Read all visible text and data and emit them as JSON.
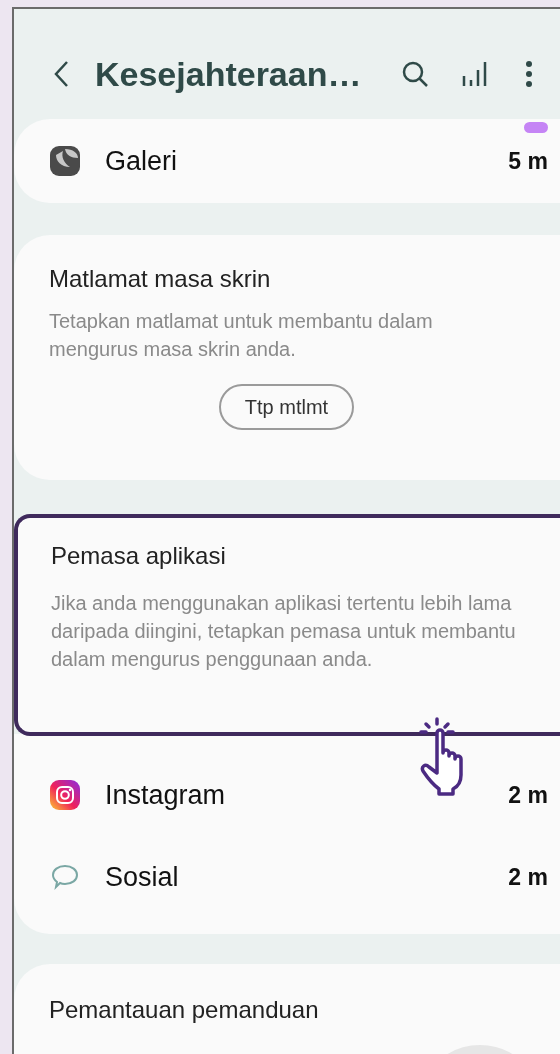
{
  "header": {
    "title": "Kesejahteraan…"
  },
  "top_apps": [
    {
      "name": "Galeri",
      "time": "5 m",
      "kind": "gallery"
    }
  ],
  "goal_card": {
    "title": "Matlamat masa skrin",
    "description": "Tetapkan matlamat untuk membantu dalam mengurus masa skrin anda.",
    "button": "Ttp mtlmt"
  },
  "timer_card": {
    "title": "Pemasa aplikasi",
    "description": "Jika anda menggunakan aplikasi tertentu lebih lama daripada diingini, tetapkan pemasa untuk membantu dalam mengurus penggunaan anda.",
    "highlighted": true
  },
  "apps": [
    {
      "name": "Instagram",
      "time": "2 m",
      "kind": "instagram"
    },
    {
      "name": "Sosial",
      "time": "2 m",
      "kind": "chat"
    }
  ],
  "monitor_card": {
    "title": "Pemantauan pemanduan"
  }
}
